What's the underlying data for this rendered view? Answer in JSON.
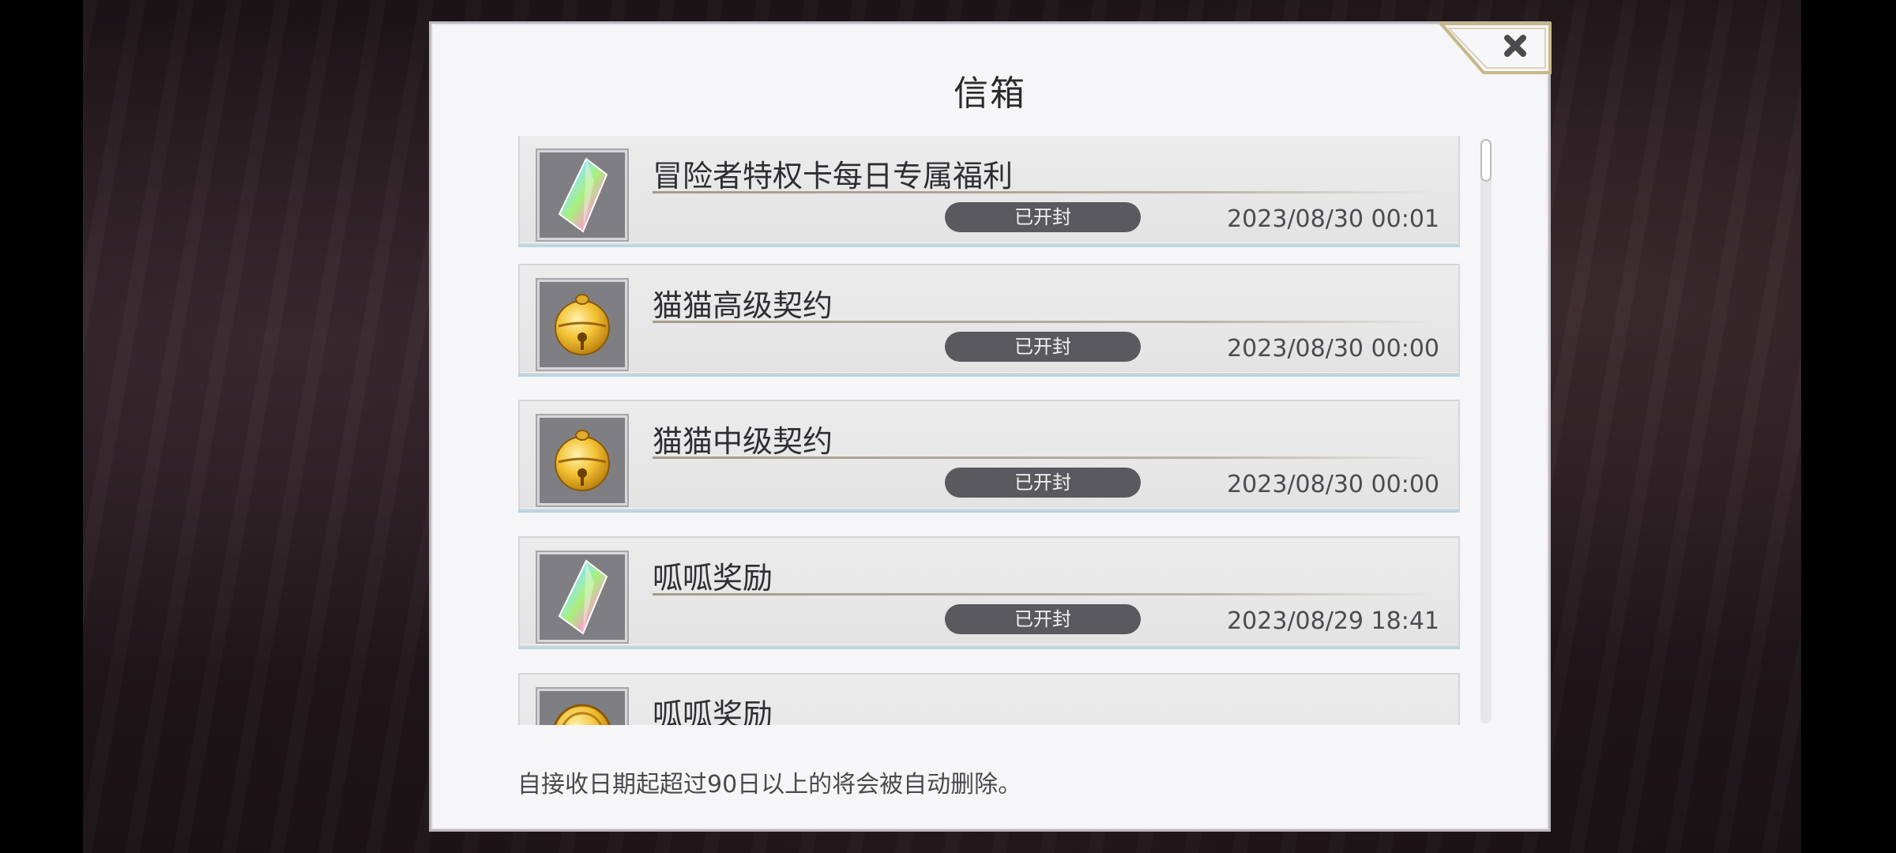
{
  "mailbox": {
    "title": "信箱",
    "footer_note": "自接收日期起超过90日以上的将会被自动删除。",
    "close_icon": "close-icon",
    "items": [
      {
        "title": "冒险者特权卡每日专属福利",
        "status": "已开封",
        "date": "2023/08/30 00:01",
        "icon": "rainbow-crystal-icon"
      },
      {
        "title": "猫猫高级契约",
        "status": "已开封",
        "date": "2023/08/30 00:00",
        "icon": "golden-bell-icon"
      },
      {
        "title": "猫猫中级契约",
        "status": "已开封",
        "date": "2023/08/30 00:00",
        "icon": "golden-bell-icon"
      },
      {
        "title": "呱呱奖励",
        "status": "已开封",
        "date": "2023/08/29 18:41",
        "icon": "rainbow-crystal-icon"
      },
      {
        "title": "呱呱奖励",
        "status": "",
        "date": "",
        "icon": "gold-coin-icon"
      }
    ]
  }
}
